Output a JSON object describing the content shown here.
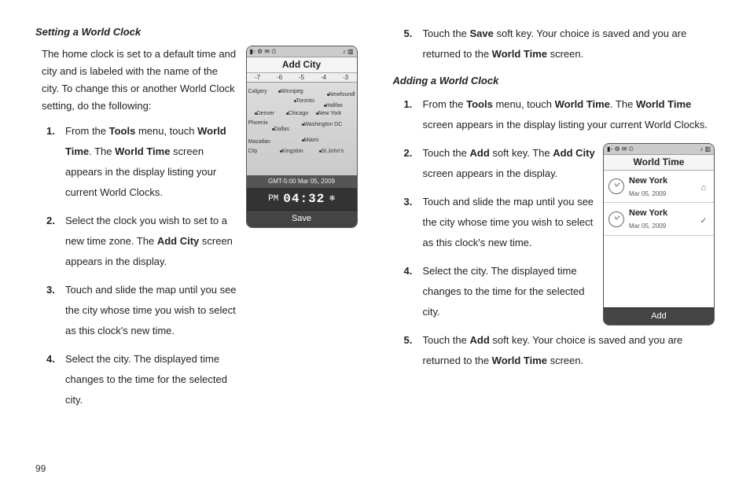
{
  "page_number": "99",
  "left": {
    "heading": "Setting a World Clock",
    "intro": "The home clock is set to a default time and city and is labeled with the name of the city. To change this or another World Clock setting, do the following:",
    "steps": {
      "s1a": "From the ",
      "s1b": "Tools",
      "s1c": " menu, touch ",
      "s1d": "World Time",
      "s1e": ". The ",
      "s1f": "World Time",
      "s1g": " screen appears in the display listing your current World Clocks.",
      "s2a": "Select the clock you wish to set to a new time zone. The ",
      "s2b": "Add City",
      "s2c": " screen appears in the display.",
      "s3": "Touch and slide the map until you see the city whose time you wish to select as this clock's new time.",
      "s4": "Select the city. The displayed time changes to the time for the selected city."
    },
    "phone": {
      "title": "Add City",
      "scale": {
        "a": "-7",
        "b": "-6",
        "c": "-5",
        "d": "-4",
        "e": "-3"
      },
      "cities": {
        "calgary": "Calgary",
        "winnipeg": "Winnipeg",
        "toronto": "Toronto",
        "newfound": "Newfoundl",
        "halifax": "Halifax",
        "denver": "Denver",
        "chicago": "Chicago",
        "newyork": "New York",
        "phoenix": "Phoenix",
        "dallas": "Dallas",
        "washington": "Washington DC",
        "mazatlan": "Mazatlan",
        "miami": "Miami",
        "city": "City",
        "kingston": "Kingston",
        "stjohns": "St.John's"
      },
      "tz": "GMT-5:00 Mar 05, 2009",
      "ampm": "PM",
      "time": "04:32",
      "softkey": "Save"
    }
  },
  "right": {
    "step5": {
      "a": "Touch the ",
      "b": "Save",
      "c": " soft key. Your choice is saved and you are returned to the ",
      "d": "World Time",
      "e": " screen."
    },
    "heading": "Adding a World Clock",
    "steps": {
      "s1a": "From the ",
      "s1b": "Tools",
      "s1c": " menu, touch ",
      "s1d": "World Time",
      "s1e": ". The ",
      "s1f": "World Time",
      "s1g": " screen appears in the display listing your current World Clocks.",
      "s2a": "Touch the ",
      "s2b": "Add",
      "s2c": " soft key. The ",
      "s2d": "Add City",
      "s2e": " screen appears in the display.",
      "s3": "Touch and slide the map until you see the city whose time you wish to select as this clock's new time.",
      "s4": "Select the city. The displayed time changes to the time for the selected city.",
      "s5a": "Touch the ",
      "s5b": "Add",
      "s5c": " soft key. Your choice is saved and you are returned to the ",
      "s5d": "World Time",
      "s5e": " screen."
    },
    "phone": {
      "title": "World Time",
      "item1": {
        "city": "New York",
        "date": "Mar 05, 2009",
        "mark": "⌂"
      },
      "item2": {
        "city": "New York",
        "date": "Mar 05, 2009",
        "mark": "✓"
      },
      "softkey": "Add"
    }
  }
}
